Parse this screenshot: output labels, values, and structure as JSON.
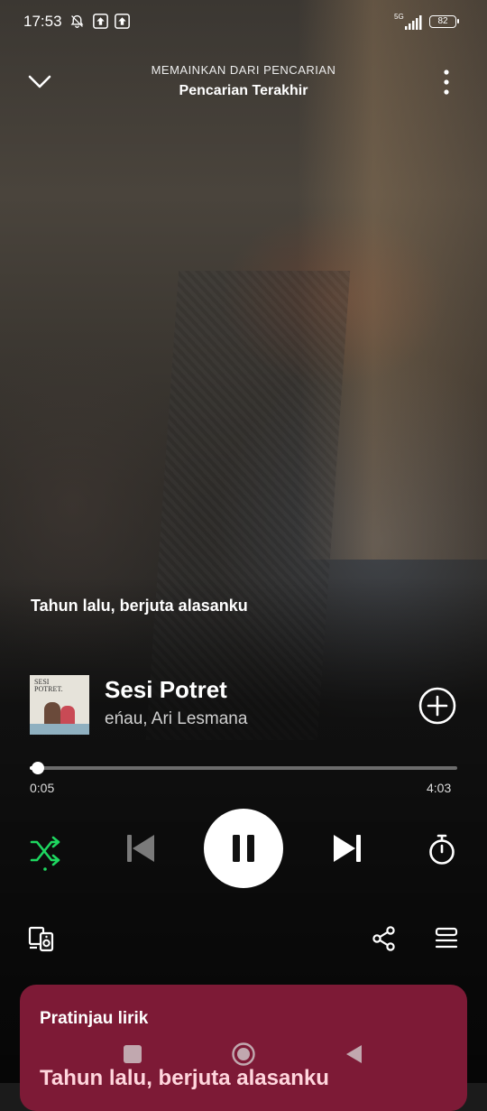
{
  "status_bar": {
    "time": "17:53",
    "network": "5G",
    "battery": "82",
    "icons": [
      "mute-bell-icon",
      "upload-icon",
      "upload-icon",
      "signal-icon",
      "battery-icon"
    ]
  },
  "header": {
    "context_label": "MEMAINKAN DARI PENCARIAN",
    "context_name": "Pencarian Terakhir",
    "icons": [
      "chevron-down-icon",
      "more-vertical-icon"
    ]
  },
  "current_lyric": "Tahun lalu, berjuta alasanku",
  "track": {
    "title": "Sesi Potret",
    "artist": "eńau, Ari Lesmana",
    "cover_text": "SESI POTRET",
    "elapsed": "0:05",
    "total": "4:03",
    "progress_fraction": 0.02
  },
  "controls": {
    "icons": [
      "shuffle-icon",
      "previous-icon",
      "pause-icon",
      "next-icon",
      "sleep-timer-icon"
    ],
    "accent_color": "#1ed760"
  },
  "bottom_actions": {
    "icons": [
      "connect-device-icon",
      "share-icon",
      "queue-icon"
    ]
  },
  "lyrics_card": {
    "title": "Pratinjau lirik",
    "preview": "Tahun lalu, berjuta alasanku",
    "color": "#7d1a36"
  },
  "nav_bar": {
    "icons": [
      "recents-square-icon",
      "home-circle-icon",
      "back-triangle-icon"
    ]
  }
}
